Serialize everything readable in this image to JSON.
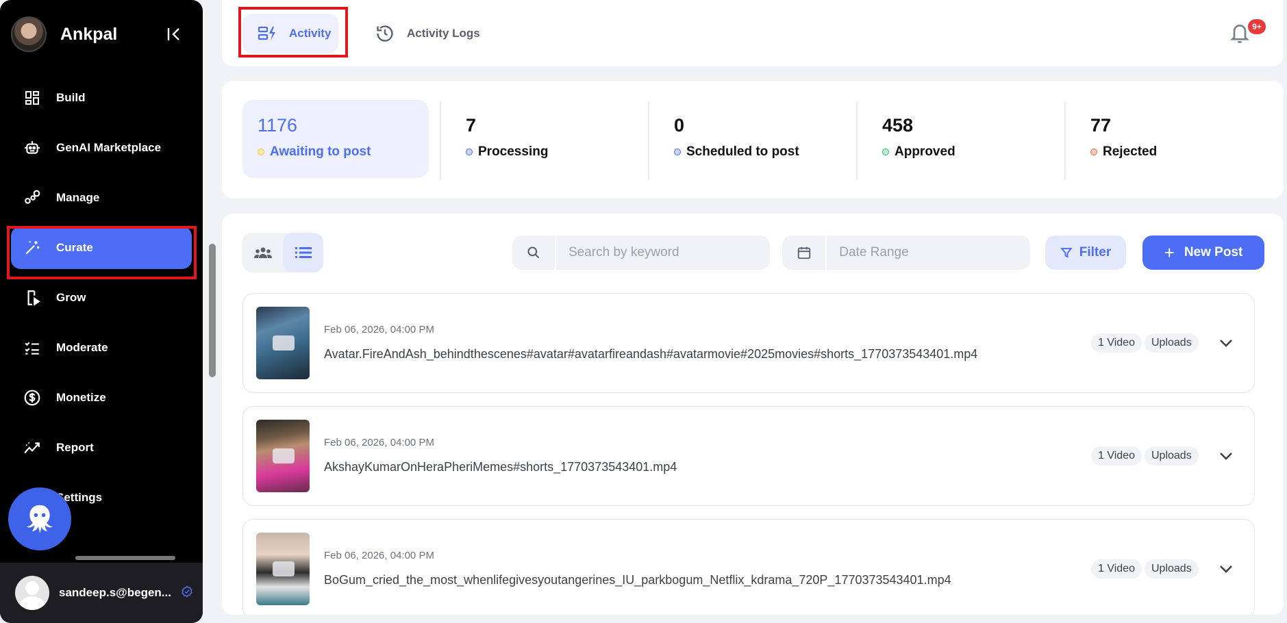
{
  "app": {
    "name": "Ankpal"
  },
  "sidebar": {
    "items": [
      {
        "label": "Build",
        "icon": "grid-icon"
      },
      {
        "label": "GenAI Marketplace",
        "icon": "robot-icon"
      },
      {
        "label": "Manage",
        "icon": "nodes-icon"
      },
      {
        "label": "Curate",
        "icon": "magic-wand-icon",
        "active": true
      },
      {
        "label": "Grow",
        "icon": "phone-play-icon"
      },
      {
        "label": "Moderate",
        "icon": "checklist-icon"
      },
      {
        "label": "Monetize",
        "icon": "dollar-icon"
      },
      {
        "label": "Report",
        "icon": "trend-icon"
      },
      {
        "label": "Settings",
        "icon": "gear-icon"
      }
    ],
    "user_email": "sandeep.s@begen..."
  },
  "tabs": {
    "activity": "Activity",
    "activity_logs": "Activity Logs"
  },
  "notifications": {
    "badge": "9+"
  },
  "stats": [
    {
      "value": "1176",
      "label": "Awaiting to post",
      "color": "#f5c542",
      "active": true
    },
    {
      "value": "7",
      "label": "Processing",
      "color": "#4c6ef5"
    },
    {
      "value": "0",
      "label": "Scheduled to post",
      "color": "#4c6ef5"
    },
    {
      "value": "458",
      "label": "Approved",
      "color": "#2fbf71"
    },
    {
      "value": "77",
      "label": "Rejected",
      "color": "#f06a4a"
    }
  ],
  "toolbar": {
    "search_placeholder": "Search by keyword",
    "date_placeholder": "Date Range",
    "filter_label": "Filter",
    "new_post_label": "New Post"
  },
  "posts": [
    {
      "date": "Feb 06, 2026, 04:00 PM",
      "name": "Avatar.FireAndAsh_behindthescenes#avatar#avatarfireandash#avatarmovie#2025movies#shorts_1770373543401.mp4",
      "count": "1 Video",
      "status": "Uploads"
    },
    {
      "date": "Feb 06, 2026, 04:00 PM",
      "name": "AkshayKumarOnHeraPheriMemes#shorts_1770373543401.mp4",
      "count": "1 Video",
      "status": "Uploads"
    },
    {
      "date": "Feb 06, 2026, 04:00 PM",
      "name": "BoGum_cried_the_most_whenlifegivesyoutangerines_IU_parkbogum_Netflix_kdrama_720P_1770373543401.mp4",
      "count": "1 Video",
      "status": "Uploads"
    }
  ],
  "colors": {
    "accent": "#4c6ef5",
    "highlight": "#e2161e",
    "sidebar": "#000000"
  }
}
